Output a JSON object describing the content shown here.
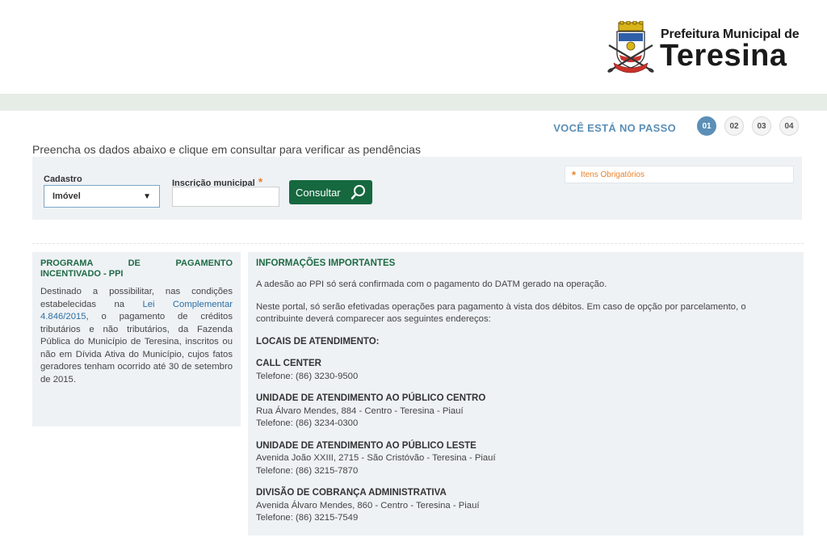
{
  "header": {
    "logo_line1": "Prefeitura Municipal de",
    "logo_line2": "Teresina"
  },
  "steps": {
    "label": "VOCÊ ESTÁ NO PASSO",
    "items": [
      "01",
      "02",
      "03",
      "04"
    ],
    "active": "01"
  },
  "instruction": "Preencha os dados abaixo e clique em consultar para verificar as pendências",
  "form": {
    "cadastro_label": "Cadastro",
    "cadastro_value": "Imóvel",
    "inscricao_label": "Inscrição municipal",
    "inscricao_value": "",
    "required_star": "*",
    "consultar_label": "Consultar",
    "required_legend": "Itens Obrigatórios"
  },
  "ppi": {
    "title_line1": "PROGRAMA DE PAGAMENTO",
    "title_line2": "INCENTIVADO - PPI",
    "text_before": "Destinado a possibilitar, nas condições estabelecidas na ",
    "link": "Lei Complementar 4.846/2015",
    "text_after": ", o pagamento de créditos tributários e não tributários, da Fazenda Pública do Município de Teresina, inscritos ou não em Dívida Ativa do Município, cujos fatos geradores tenham ocorrido até 30 de setembro de 2015."
  },
  "info": {
    "title": "INFORMAÇÕES IMPORTANTES",
    "p1": "A adesão ao PPI só será confirmada com o pagamento do DATM gerado na operação.",
    "p2": "Neste portal, só serão efetivadas operações para pagamento à vista dos débitos. Em caso de opção por parcelamento, o contribuinte deverá comparecer aos seguintes endereços:",
    "locais_title": "LOCAIS DE ATENDIMENTO:",
    "locations": [
      {
        "name": "CALL CENTER",
        "address": "",
        "phone": "Telefone: (86) 3230-9500"
      },
      {
        "name": "UNIDADE DE ATENDIMENTO AO PÚBLICO CENTRO",
        "address": "Rua Álvaro Mendes, 884 - Centro - Teresina - Piauí",
        "phone": "Telefone: (86) 3234-0300"
      },
      {
        "name": "UNIDADE DE ATENDIMENTO AO PÚBLICO LESTE",
        "address": "Avenida João XXIII, 2715 - São Cristóvão - Teresina - Piauí",
        "phone": "Telefone: (86) 3215-7870"
      },
      {
        "name": "DIVISÃO DE COBRANÇA ADMINISTRATIVA",
        "address": "Avenida Álvaro Mendes, 860 - Centro - Teresina - Piauí",
        "phone": "Telefone: (86) 3215-7549"
      }
    ]
  },
  "colors": {
    "accent_blue": "#5b8fb7",
    "button_green": "#16683f",
    "title_green": "#1f6a45",
    "required_orange": "#e8822b",
    "panel_bg": "#eef2f5"
  },
  "icons": {
    "logo": "teresina-crest-icon",
    "search": "search-icon",
    "dropdown": "chevron-down-icon",
    "required": "asterisk-icon"
  }
}
